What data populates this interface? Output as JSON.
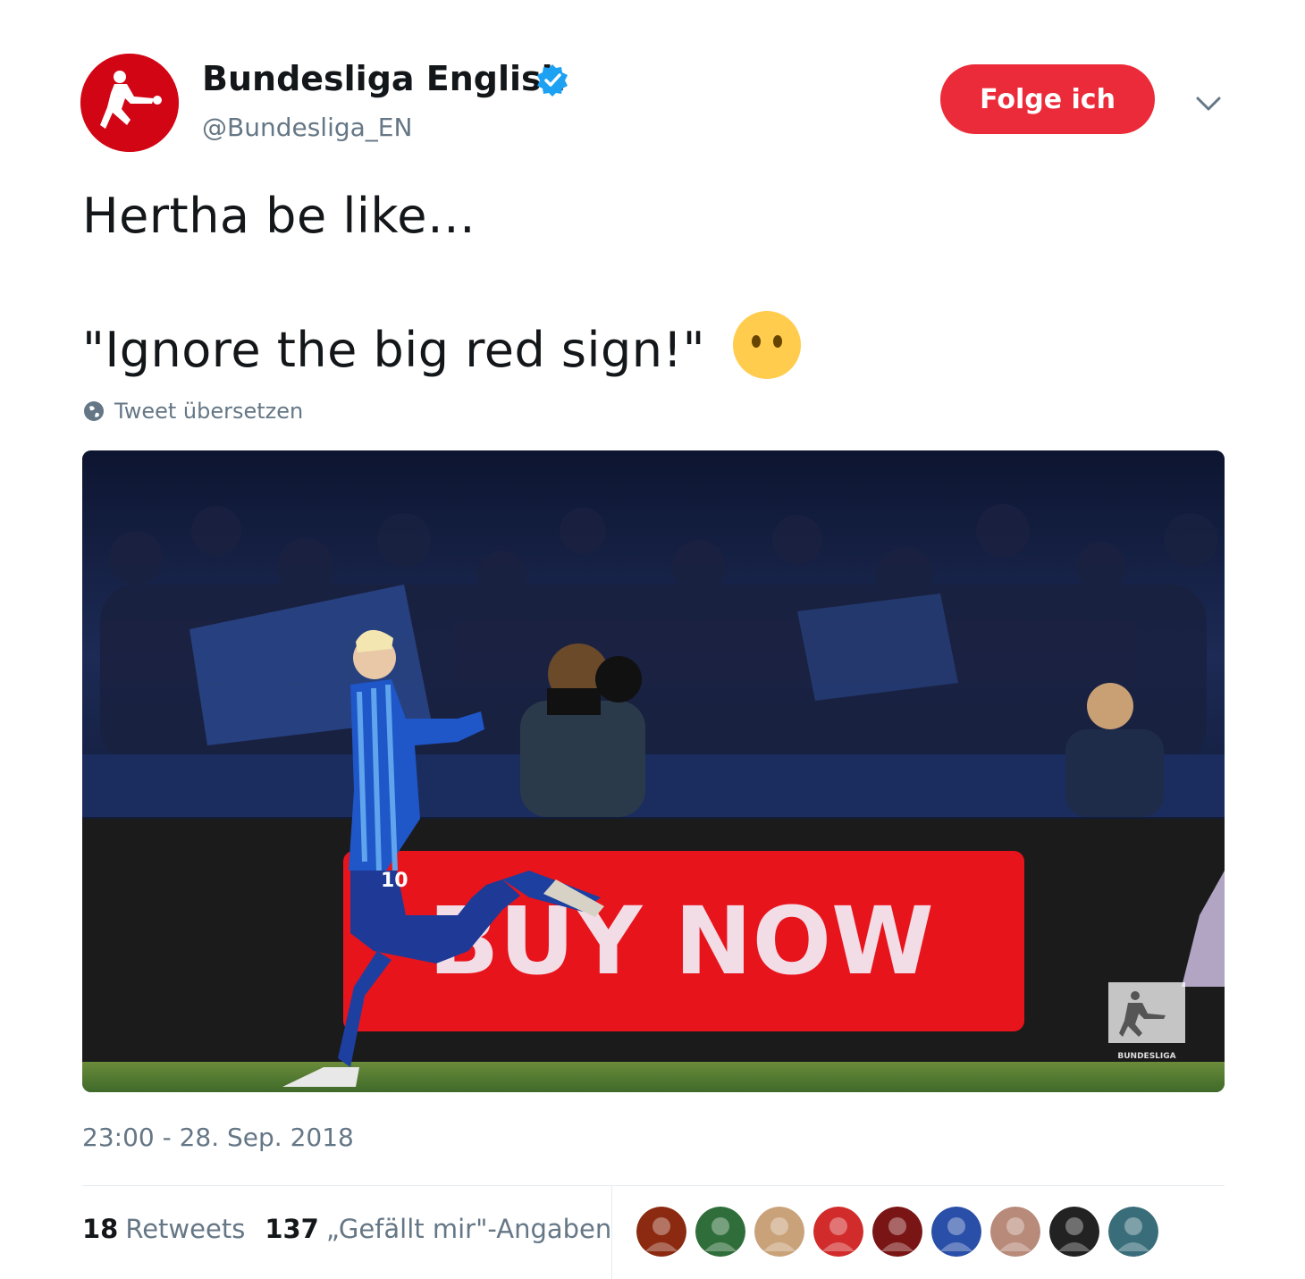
{
  "tweet": {
    "author": {
      "display_name": "Bundesliga English",
      "handle": "@Bundesliga_EN",
      "verified_icon": "verified-badge-icon",
      "avatar_icon": "bundesliga-logo-icon",
      "avatar_color": "#d20515"
    },
    "follow_label": "Folge ich",
    "follow_color": "#ec2b3a",
    "text_line1": "Hertha be like…",
    "text_line2": "\"Ignore the big red sign!\"",
    "emoji": "face-without-mouth-emoji",
    "translate_label": "Tweet übersetzen",
    "media": {
      "sign_text": "BUY NOW",
      "watermark_text": "BUNDESLIGA",
      "jersey_number": "10"
    },
    "timestamp": "23:00 - 28. Sep. 2018",
    "stats": {
      "retweets_count": "18",
      "retweets_label": "Retweets",
      "likes_count": "137",
      "likes_label": "„Gefällt mir\"-Angaben"
    },
    "likers": [
      {
        "color": "#8b2a10"
      },
      {
        "color": "#2f6e3a"
      },
      {
        "color": "#c9a27a"
      },
      {
        "color": "#d22b2b"
      },
      {
        "color": "#7a1515"
      },
      {
        "color": "#2a4fa8"
      },
      {
        "color": "#b88a7a"
      },
      {
        "color": "#222222"
      },
      {
        "color": "#3a6d7a"
      }
    ]
  }
}
